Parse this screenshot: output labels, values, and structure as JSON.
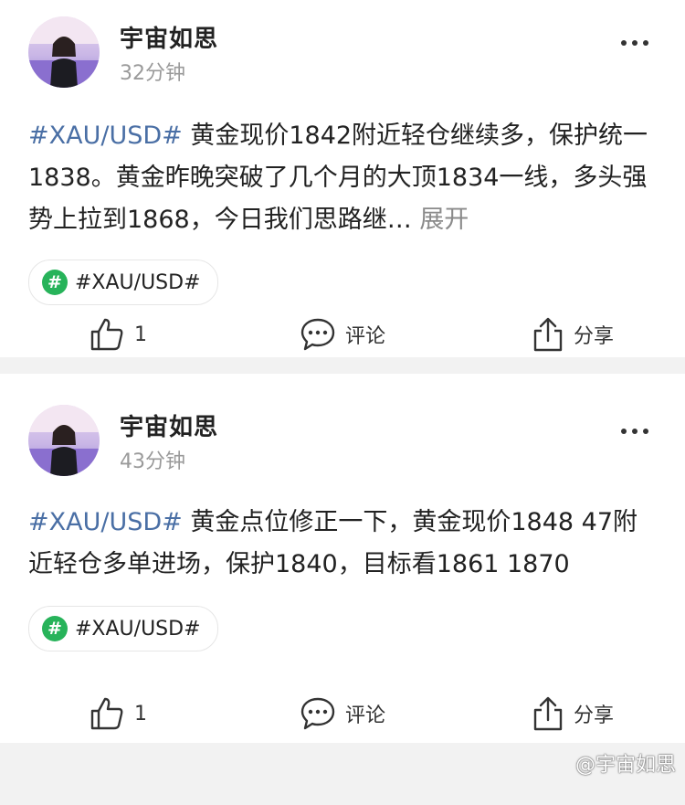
{
  "posts": [
    {
      "author": "宇宙如思",
      "time": "32分钟",
      "hashtag": "#XAU/USD#",
      "text": " 黄金现价1842附近轻仓继续多，保护统一1838。黄金昨晚突破了几个月的大顶1834一线，多头强势上拉到1868，今日我们思路继…",
      "expand_label": "展开",
      "tag_chip": "#XAU/USD#",
      "like_count": "1",
      "comment_label": "评论",
      "share_label": "分享"
    },
    {
      "author": "宇宙如思",
      "time": "43分钟",
      "hashtag": "#XAU/USD#",
      "text": " 黄金点位修正一下，黄金现价1848 47附近轻仓多单进场，保护1840，目标看1861 1870",
      "tag_chip": "#XAU/USD#",
      "like_count": "1",
      "comment_label": "评论",
      "share_label": "分享"
    }
  ],
  "watermark": "@宇宙如思",
  "icons": {
    "more": "more-dots-icon",
    "like": "thumbs-up-icon",
    "comment": "comment-bubble-icon",
    "share": "share-upload-icon",
    "tag": "hashtag-icon"
  },
  "colors": {
    "hashtag": "#4a6fa5",
    "tag_icon_bg": "#27b35a",
    "muted": "#9a9a9a"
  }
}
